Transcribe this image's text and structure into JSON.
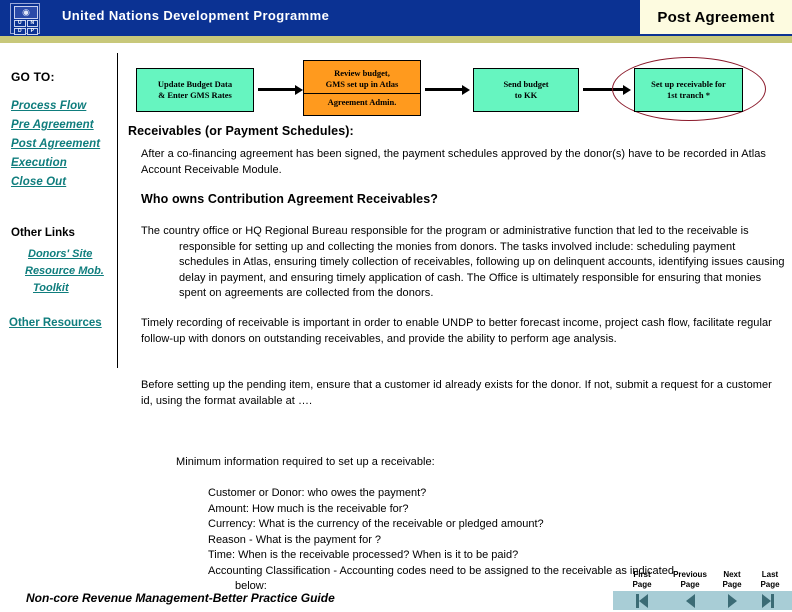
{
  "header": {
    "org_title": "United Nations Development Programme",
    "page_title": "Post Agreement",
    "logo": {
      "emblem_icon": "un-emblem-icon",
      "letters": [
        "U",
        "N",
        "D",
        "P"
      ]
    },
    "colors": {
      "bar": "#0b3293",
      "band": "#c8c87a",
      "title_box": "#fdfbe0"
    }
  },
  "sidebar": {
    "goto_label": "GO TO:",
    "links": [
      {
        "label": "Process Flow"
      },
      {
        "label": "Pre Agreement"
      },
      {
        "label": "Post Agreement"
      },
      {
        "label": "Execution"
      },
      {
        "label": "Close Out"
      }
    ],
    "other_links_label": "Other Links",
    "sub_links": [
      {
        "label": "Donors' Site"
      },
      {
        "label": "Resource Mob."
      },
      {
        "label": "Toolkit"
      }
    ],
    "other_resources_label": "Other Resources",
    "link_color": "#0f7d7d"
  },
  "flowchart": {
    "boxes": [
      {
        "id": "update-budget",
        "line1": "Update Budget Data",
        "line2": "& Enter GMS Rates",
        "color": "#66f5c0"
      },
      {
        "id": "review-budget",
        "line1": "Review budget,",
        "line2": "GMS set up in Atlas",
        "line3": "Agreement Admin.",
        "color": "#ff9a1e"
      },
      {
        "id": "send-budget",
        "line1": "Send budget",
        "line2": "to KK",
        "color": "#66f5c0"
      },
      {
        "id": "set-up-receivable",
        "line1": "Set up receivable for",
        "line2": "1st tranch *",
        "color": "#66f5c0"
      }
    ],
    "highlight_ellipse_color": "#8b1a2b"
  },
  "main": {
    "heading1": "Receivables (or Payment Schedules):",
    "para1": "After a co-financing agreement has been signed, the  payment schedules approved by the donor(s) have to be recorded in Atlas Account Receivable Module.",
    "heading2": "Who owns Contribution Agreement Receivables?",
    "para2": "The country office or HQ Regional Bureau  responsible for the program or administrative function that led to the receivable is responsible for setting up and collecting the monies from donors.   The tasks involved include: scheduling payment schedules in Atlas, ensuring timely collection of receivables, following up on delinquent accounts, identifying issues causing delay in payment, and ensuring timely application of cash. The Office is ultimately responsible for ensuring that monies spent on agreements are collected from the donors.",
    "para3": "Timely recording of receivable is important in order  to enable  UNDP to better forecast income, project cash flow, facilitate regular follow-up with donors on outstanding receivables,  and provide the ability to perform age analysis.",
    "para4": "Before setting up the pending item, ensure that a customer id already exists for the donor.  If not, submit a request for a customer id, using the format available at ….",
    "para5": "Minimum information required to set up a receivable:",
    "requirements": [
      "Customer or Donor:  who owes the payment?",
      " Amount:  How much is the receivable for?",
      "Currency:  What is the currency of the receivable or pledged amount?",
      "Reason  - What is the payment  for ?",
      "Time:   When is the receivable processed? When is it to be paid?",
      "Accounting Classification - Accounting codes need to be assigned to the receivable as indicated",
      "below:"
    ]
  },
  "footer": {
    "guide_title": "Non-core Revenue Management-Better Practice Guide",
    "nav": [
      {
        "caption_line1": "First",
        "caption_line2": "Page",
        "icon": "first-page-icon"
      },
      {
        "caption_line1": "Previous",
        "caption_line2": "Page",
        "icon": "previous-page-icon"
      },
      {
        "caption_line1": "Next",
        "caption_line2": "Page",
        "icon": "next-page-icon"
      },
      {
        "caption_line1": "Last",
        "caption_line2": "Page",
        "icon": "last-page-icon"
      }
    ],
    "nav_bar_color": "#a8cdd6"
  }
}
